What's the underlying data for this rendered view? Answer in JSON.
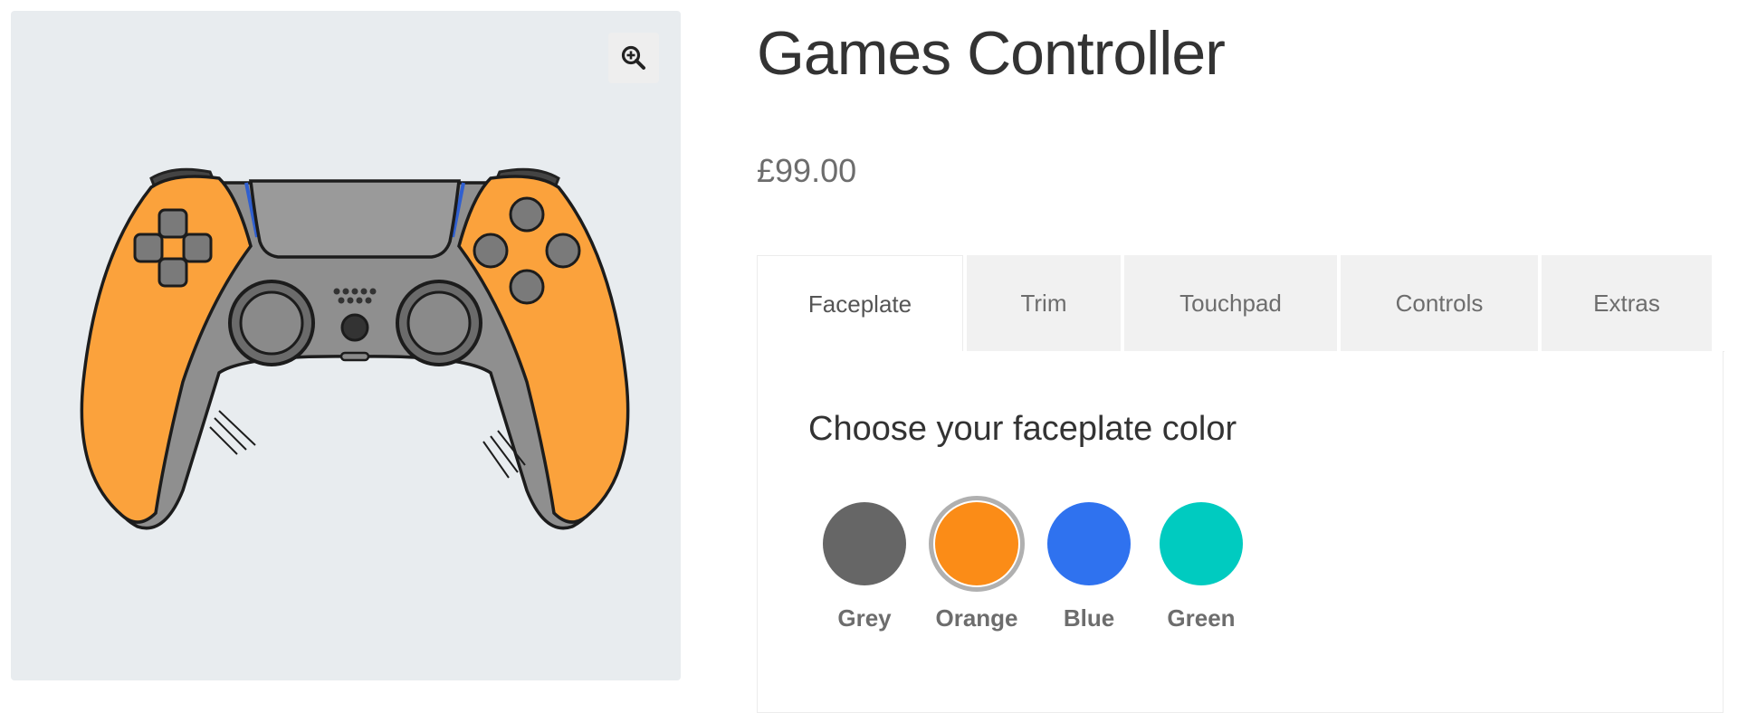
{
  "product": {
    "title": "Games Controller",
    "price": "£99.00",
    "image_alt": "Games controller illustration with orange faceplate",
    "zoom_icon": "zoom-in-icon"
  },
  "tabs": [
    {
      "label": "Faceplate",
      "active": true
    },
    {
      "label": "Trim",
      "active": false
    },
    {
      "label": "Touchpad",
      "active": false
    },
    {
      "label": "Controls",
      "active": false
    },
    {
      "label": "Extras",
      "active": false
    }
  ],
  "panel": {
    "heading": "Choose your faceplate color",
    "selected": "Orange",
    "colors": [
      {
        "label": "Grey",
        "hex": "#666666"
      },
      {
        "label": "Orange",
        "hex": "#fb8c17"
      },
      {
        "label": "Blue",
        "hex": "#2f72ef"
      },
      {
        "label": "Green",
        "hex": "#00cbc0"
      }
    ]
  },
  "colors": {
    "gallery_bg": "#e8ecef",
    "faceplate": "#fba23c",
    "body": "#8a8a8a"
  }
}
